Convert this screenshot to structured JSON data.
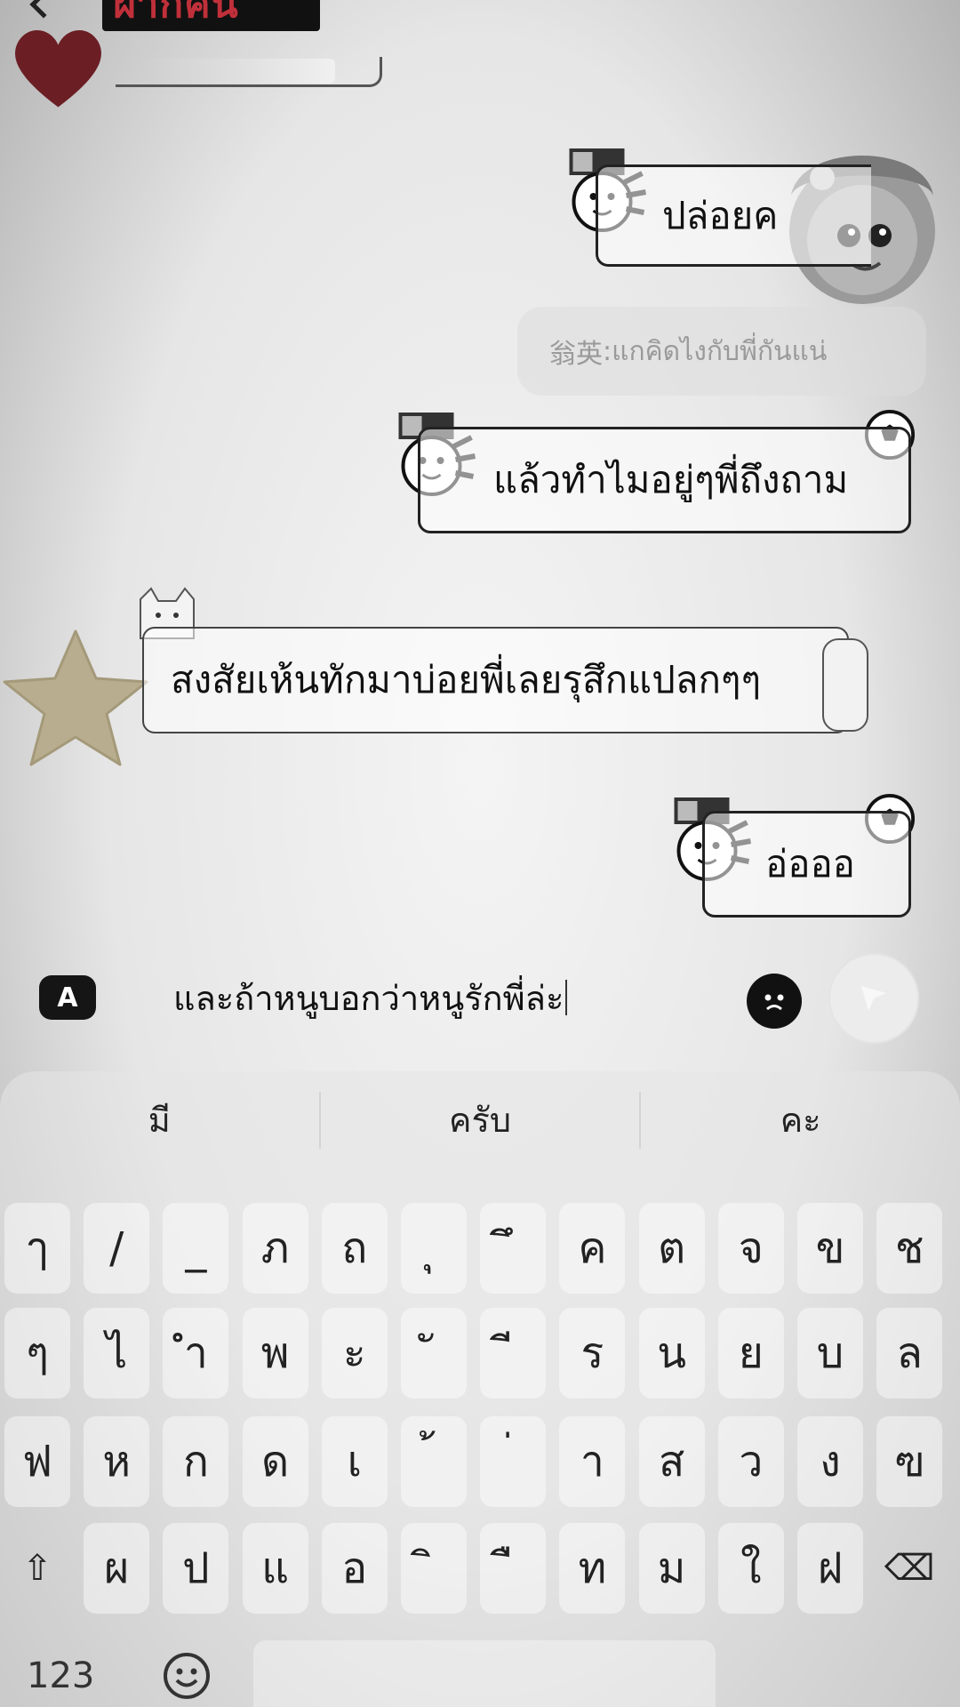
{
  "header": {
    "contact_name": "ฝากคน"
  },
  "messages": [
    {
      "id": "msg1",
      "text": "ปล่อยค"
    },
    {
      "id": "reply",
      "sender": "翁英",
      "separator": ": ",
      "text": "แกคิดไงกับพี่กันแน่"
    },
    {
      "id": "msg2",
      "text": "แล้วทำไมอยู่ๆพี่ถึงถาม"
    },
    {
      "id": "msg3",
      "text": "สงสัยเห้นทักมาบ่อยพี่เลยรุสึกแปลกๆๆ"
    },
    {
      "id": "msg4",
      "text": "อ่อออ"
    }
  ],
  "composer": {
    "translate_label": "A",
    "input_value": "และถ้าหนูบอกว่าหนูรักพี่ล่ะ"
  },
  "keyboard": {
    "suggestions": [
      "มี",
      "ครับ",
      "คะ"
    ],
    "rows": [
      [
        "ๅ",
        "/",
        "_",
        "ภ",
        "ถ",
        "ุ",
        "ึ",
        "ค",
        "ต",
        "จ",
        "ข",
        "ช"
      ],
      [
        "ๆ",
        "ไ",
        "ำ",
        "พ",
        "ะ",
        "ั",
        "ี",
        "ร",
        "น",
        "ย",
        "บ",
        "ล"
      ],
      [
        "ฟ",
        "ห",
        "ก",
        "ด",
        "เ",
        "้",
        "่",
        "า",
        "ส",
        "ว",
        "ง",
        "ฃ"
      ],
      [
        "⇧",
        "ผ",
        "ป",
        "แ",
        "อ",
        "ิ",
        "ื",
        "ท",
        "ม",
        "ใ",
        "ฝ",
        "⌫"
      ]
    ],
    "numbers_label": "123"
  },
  "icons": {
    "back": "chevron-left-icon",
    "send": "send-icon",
    "emoji": "emoji-icon",
    "keyboard_emoji": "smiley-icon"
  }
}
